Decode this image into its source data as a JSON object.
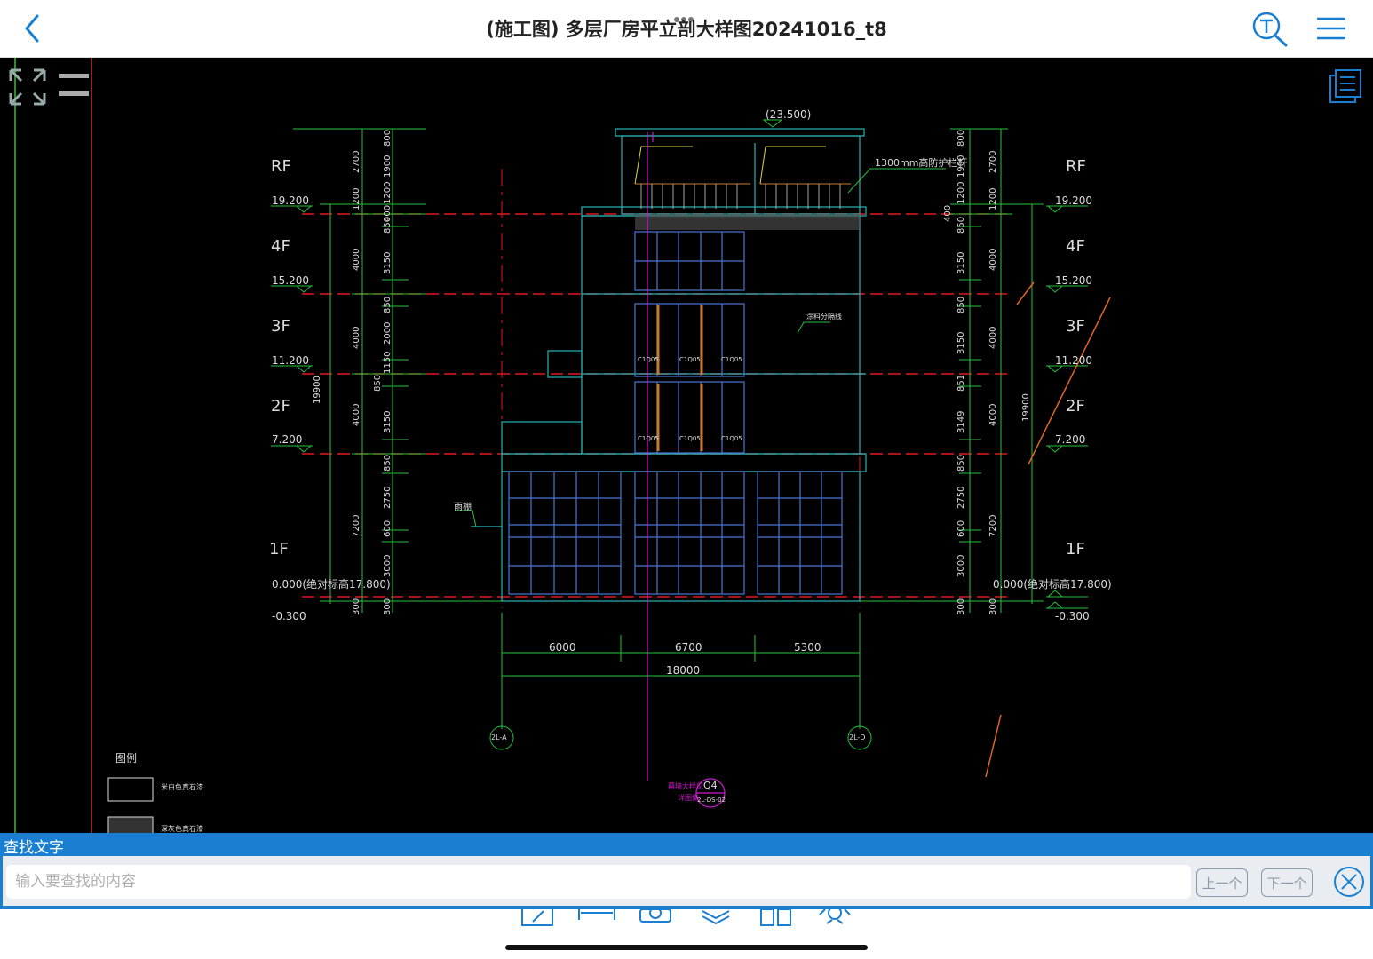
{
  "header": {
    "title": "(施工图) 多层厂房平立剖大样图20241016_t8"
  },
  "drawing": {
    "levels_left": [
      {
        "floor": "RF",
        "elev": "19.200"
      },
      {
        "floor": "4F",
        "elev": "15.200"
      },
      {
        "floor": "3F",
        "elev": "11.200"
      },
      {
        "floor": "2F",
        "elev": "7.200"
      },
      {
        "floor": "1F",
        "elev": "0.000(绝对标高17.800)"
      }
    ],
    "levels_right": [
      {
        "floor": "RF",
        "elev": "19.200"
      },
      {
        "floor": "4F",
        "elev": "15.200"
      },
      {
        "floor": "3F",
        "elev": "11.200"
      },
      {
        "floor": "2F",
        "elev": "7.200"
      },
      {
        "floor": "1F",
        "elev": "0.000(绝对标高17.800)"
      }
    ],
    "minus_elev": "-0.300",
    "top_elev": "(23.500)",
    "railing_note": "1300mm高防护栏杆",
    "canopy_note": "雨棚",
    "paint_note": "涂料分隔线",
    "total_height": "19900",
    "dims_a": [
      "2700",
      "1200",
      "4000",
      "4000",
      "4000",
      "7200",
      "300"
    ],
    "dims_b": [
      "800",
      "1900",
      "1200",
      "400",
      "850",
      "3150",
      "850",
      "2000",
      "1150",
      "850",
      "3150",
      "850",
      "2750",
      "600",
      "3000",
      "300"
    ],
    "dims_b_right": [
      "800",
      "1900",
      "1200",
      "400",
      "850",
      "3150",
      "850",
      "3150",
      "851",
      "3149",
      "850",
      "2750",
      "600",
      "3000",
      "300"
    ],
    "bottom_dims": [
      "6000",
      "6700",
      "5300"
    ],
    "bottom_total": "18000",
    "axis_left": "2L-A",
    "axis_right": "2L-D",
    "detail_tag": "Q4",
    "detail_ref": "2L-DS-02",
    "detail_note_1": "幕墙大样见",
    "detail_note_2": "详图集",
    "window_tag": "C1Q05",
    "legend_title": "图例",
    "legend_item_1": "米白色真石漆",
    "legend_item_2": "深灰色真石漆"
  },
  "search": {
    "label": "查找文字",
    "placeholder": "输入要查找的内容",
    "prev_label": "上一个",
    "next_label": "下一个"
  },
  "colors": {
    "accent": "#1a7fd1",
    "green": "#23c23b",
    "red": "#e1191d",
    "blue_line": "#4a74d4",
    "magenta": "#d01ad0"
  }
}
